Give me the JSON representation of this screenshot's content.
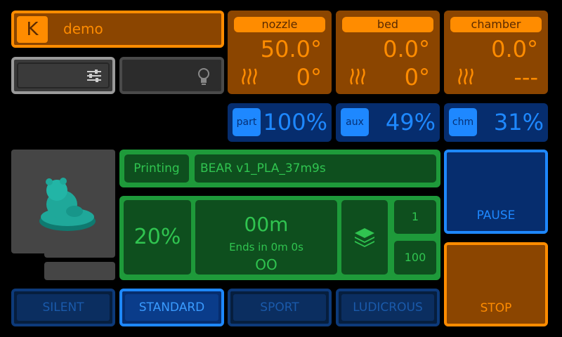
{
  "header": {
    "logo_letter": "K",
    "printer_name": "demo"
  },
  "buttons": {
    "settings_icon": "sliders-icon",
    "light_icon": "lightbulb-icon"
  },
  "temps": [
    {
      "label": "nozzle",
      "actual": "50.0°",
      "target": "0°"
    },
    {
      "label": "bed",
      "actual": "0.0°",
      "target": "0°"
    },
    {
      "label": "chamber",
      "actual": "0.0°",
      "target": "---"
    }
  ],
  "fans": [
    {
      "label": "part",
      "value": "100%"
    },
    {
      "label": "aux",
      "value": "49%"
    },
    {
      "label": "chm",
      "value": "31%"
    }
  ],
  "job": {
    "status": "Printing",
    "filename": "BEAR v1_PLA_37m9s",
    "progress": "20%",
    "progress_fraction": 0.2,
    "elapsed": "00m",
    "ends_in": "Ends in 0m 0s",
    "remaining": "OO",
    "layer_current": "1",
    "layer_total": "100"
  },
  "controls": {
    "pause": "PAUSE",
    "stop": "STOP"
  },
  "speed_modes": [
    "SILENT",
    "STANDARD",
    "SPORT",
    "LUDICROUS"
  ],
  "speed_active_index": 1,
  "colors": {
    "orange": "#ff8c00",
    "blue": "#1e88ff",
    "green": "#1e9a3a",
    "model": "#1fa89a"
  }
}
